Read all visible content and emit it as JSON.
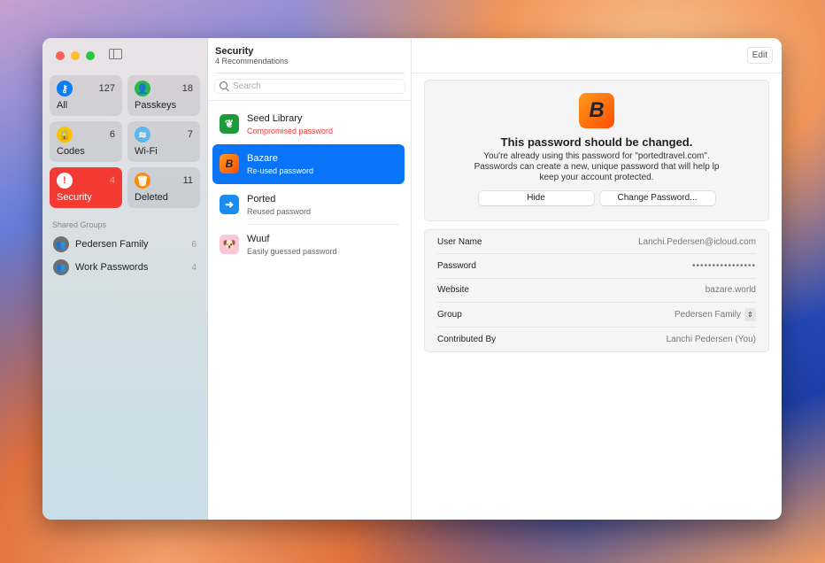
{
  "sidebar": {
    "categories": [
      {
        "label": "All",
        "count": "127",
        "color": "#0a7cf8",
        "icon": "key-icon"
      },
      {
        "label": "Passkeys",
        "count": "18",
        "color": "#2bb84a",
        "icon": "passkey-icon"
      },
      {
        "label": "Codes",
        "count": "6",
        "color": "#f8c400",
        "icon": "lock-clock-icon"
      },
      {
        "label": "Wi-Fi",
        "count": "7",
        "color": "#5ab8ef",
        "icon": "wifi-icon"
      },
      {
        "label": "Security",
        "count": "4",
        "color": "#ffffff",
        "icon": "exclamation-icon"
      },
      {
        "label": "Deleted",
        "count": "11",
        "color": "#f78c0c",
        "icon": "trash-icon"
      }
    ],
    "shared_groups_heading": "Shared Groups",
    "groups": [
      {
        "label": "Pedersen Family",
        "count": "6"
      },
      {
        "label": "Work Passwords",
        "count": "4"
      }
    ]
  },
  "list": {
    "title": "Security",
    "subtitle": "4 Recommendations",
    "search_placeholder": "Search",
    "items": [
      {
        "title": "Seed Library",
        "subtitle": "Compromised password",
        "color": "#1e9a3a"
      },
      {
        "title": "Bazare",
        "subtitle": "Re-used password",
        "color": "#ff6a0a"
      },
      {
        "title": "Ported",
        "subtitle": "Reused password",
        "color": "#1a8ef0"
      },
      {
        "title": "Wuuf",
        "subtitle": "Easily guessed password",
        "color": "#fbc6d8"
      }
    ]
  },
  "detail": {
    "edit_label": "Edit",
    "warning_title": "This password should be changed.",
    "warning_body": "You're already using this password for \"portedtravel.com\". Passwords can create a new, unique password that will help lp keep your account protected.",
    "hide_label": "Hide",
    "change_label": "Change Password...",
    "fields": [
      {
        "label": "User Name",
        "value": "Lanchi.Pedersen@icloud.com"
      },
      {
        "label": "Password",
        "value": "••••••••••••••••"
      },
      {
        "label": "Website",
        "value": "bazare.world"
      },
      {
        "label": "Group",
        "value": "Pedersen Family"
      },
      {
        "label": "Contributed By",
        "value": "Lanchi Pedersen (You)"
      }
    ]
  },
  "colors": {
    "accent": "#0a74f8",
    "danger": "#f33a33"
  }
}
